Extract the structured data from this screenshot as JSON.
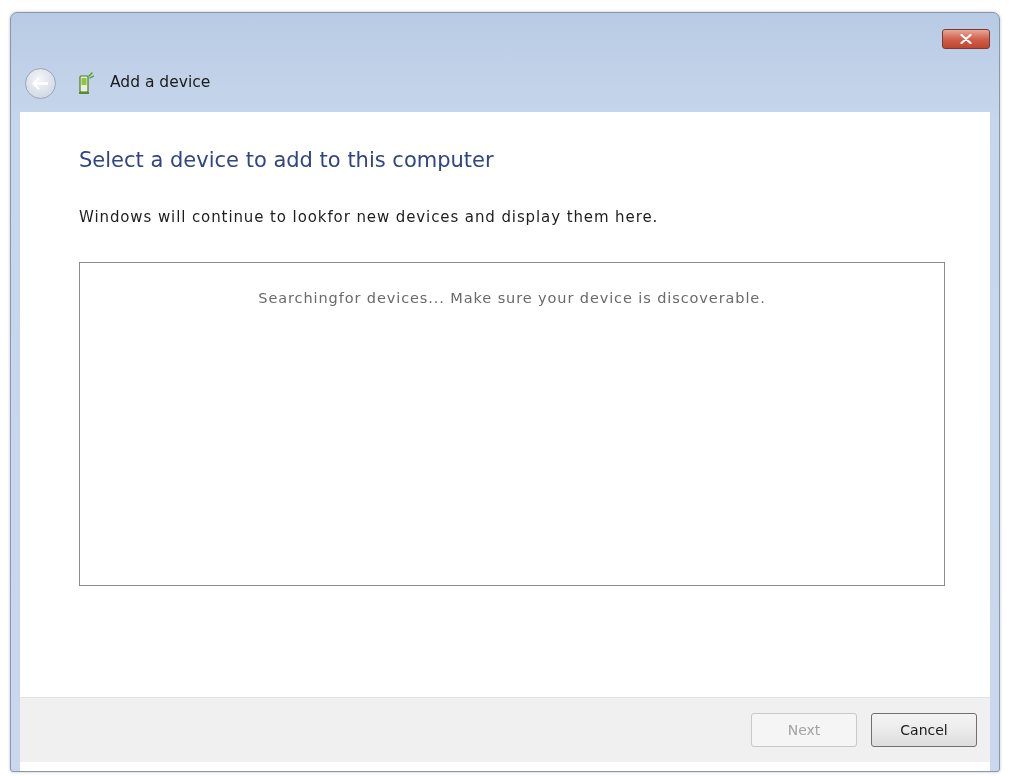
{
  "window": {
    "title": "Add a device",
    "back_button": {
      "disabled": true
    }
  },
  "content": {
    "heading": "Select a device to add to this computer",
    "description": "Windows will continue to lookfor new devices and display them here.",
    "device_list": {
      "status_text": "Searchingfor devices... Make sure your device is discoverable."
    }
  },
  "buttons": [
    {
      "label": "Next",
      "disabled": true
    },
    {
      "label": "Cancel",
      "disabled": false
    }
  ]
}
